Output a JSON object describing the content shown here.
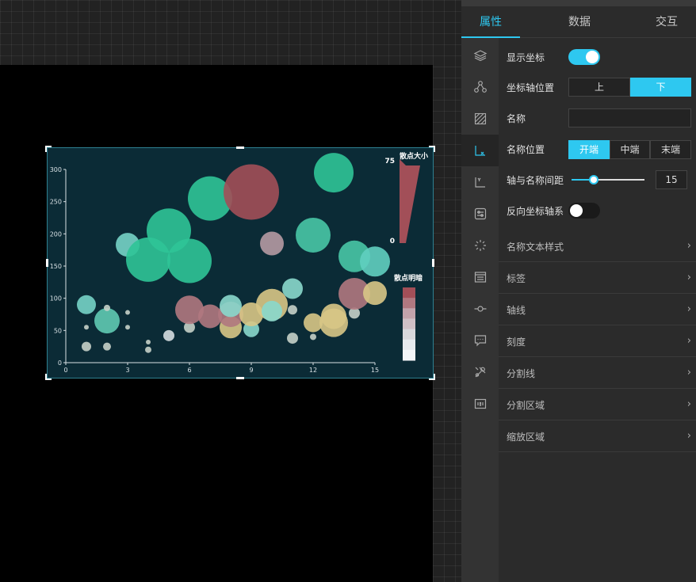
{
  "colors": {
    "accent": "#2ec8f0",
    "chart_bg": "#0b2b36",
    "bubble_green": "#2fc497",
    "bubble_red": "#a24f58",
    "bubble_yellow": "#d8c786"
  },
  "tabs": [
    {
      "label": "属性",
      "active": true
    },
    {
      "label": "数据",
      "active": false
    },
    {
      "label": "交互",
      "active": false
    }
  ],
  "side_icons": [
    {
      "name": "layers-icon"
    },
    {
      "name": "nodes-icon"
    },
    {
      "name": "grid-pattern-icon"
    },
    {
      "name": "x-axis-icon",
      "active": true
    },
    {
      "name": "y-axis-icon"
    },
    {
      "name": "settings-card-icon"
    },
    {
      "name": "sparkle-icon"
    },
    {
      "name": "legend-list-icon"
    },
    {
      "name": "line-node-icon"
    },
    {
      "name": "tooltip-icon"
    },
    {
      "name": "tools-icon"
    },
    {
      "name": "ratio-icon"
    }
  ],
  "props": {
    "show_axis": {
      "label": "显示坐标",
      "on": true
    },
    "axis_position": {
      "label": "坐标轴位置",
      "options": [
        "上",
        "下"
      ],
      "selected": 1
    },
    "name": {
      "label": "名称",
      "value": ""
    },
    "name_position": {
      "label": "名称位置",
      "options": [
        "开端",
        "中端",
        "末端"
      ],
      "selected": 0
    },
    "name_gap": {
      "label": "轴与名称间距",
      "value": "15",
      "slider_fraction": 0.3
    },
    "reverse_axis": {
      "label": "反向坐标轴系",
      "on": false
    }
  },
  "sections": [
    {
      "label": "名称文本样式"
    },
    {
      "label": "标签"
    },
    {
      "label": "轴线"
    },
    {
      "label": "刻度"
    },
    {
      "label": "分割线"
    },
    {
      "label": "分割区域"
    },
    {
      "label": "缩放区域"
    }
  ],
  "chart_data": {
    "type": "scatter",
    "x_ticks": [
      "0",
      "3",
      "6",
      "9",
      "12",
      "15"
    ],
    "y_ticks": [
      "0",
      "50",
      "100",
      "150",
      "200",
      "250",
      "300"
    ],
    "xlim": [
      0,
      15
    ],
    "ylim": [
      0,
      300
    ],
    "points": [
      {
        "x": 1,
        "y": 25,
        "size": 6,
        "color": "#c5d0c8"
      },
      {
        "x": 1,
        "y": 55,
        "size": 3,
        "color": "#c5d0c8"
      },
      {
        "x": 1,
        "y": 90,
        "size": 12,
        "color": "#76d3c6"
      },
      {
        "x": 2,
        "y": 25,
        "size": 5,
        "color": "#c5d0c8"
      },
      {
        "x": 2,
        "y": 65,
        "size": 16,
        "color": "#5fcab2"
      },
      {
        "x": 2,
        "y": 85,
        "size": 4,
        "color": "#c5d0c8"
      },
      {
        "x": 3,
        "y": 55,
        "size": 3,
        "color": "#c5d0c8"
      },
      {
        "x": 3,
        "y": 78,
        "size": 3,
        "color": "#c5d0c8"
      },
      {
        "x": 3,
        "y": 183,
        "size": 15,
        "color": "#76d3c6"
      },
      {
        "x": 4,
        "y": 20,
        "size": 4,
        "color": "#c5d0c8"
      },
      {
        "x": 4,
        "y": 32,
        "size": 3,
        "color": "#c5d0c8"
      },
      {
        "x": 4,
        "y": 160,
        "size": 28,
        "color": "#2fc497"
      },
      {
        "x": 5,
        "y": 42,
        "size": 7,
        "color": "#d5dde0"
      },
      {
        "x": 5,
        "y": 205,
        "size": 28,
        "color": "#2fc497"
      },
      {
        "x": 6,
        "y": 55,
        "size": 7,
        "color": "#c5d0c8"
      },
      {
        "x": 6,
        "y": 82,
        "size": 18,
        "color": "#b07880"
      },
      {
        "x": 6,
        "y": 158,
        "size": 28,
        "color": "#2fc497"
      },
      {
        "x": 7,
        "y": 72,
        "size": 15,
        "color": "#b07880"
      },
      {
        "x": 7,
        "y": 255,
        "size": 28,
        "color": "#2fc497"
      },
      {
        "x": 8,
        "y": 55,
        "size": 14,
        "color": "#d8c786"
      },
      {
        "x": 8,
        "y": 75,
        "size": 16,
        "color": "#b07880"
      },
      {
        "x": 8,
        "y": 88,
        "size": 14,
        "color": "#8ad8cc"
      },
      {
        "x": 9,
        "y": 52,
        "size": 10,
        "color": "#8ad8cc"
      },
      {
        "x": 9,
        "y": 75,
        "size": 15,
        "color": "#d8c786"
      },
      {
        "x": 9,
        "y": 265,
        "size": 35,
        "color": "#a24f58"
      },
      {
        "x": 10,
        "y": 90,
        "size": 20,
        "color": "#d8c786"
      },
      {
        "x": 10,
        "y": 80,
        "size": 13,
        "color": "#8ad8cc"
      },
      {
        "x": 10,
        "y": 185,
        "size": 15,
        "color": "#b59aa3"
      },
      {
        "x": 11,
        "y": 38,
        "size": 7,
        "color": "#c5d0c8"
      },
      {
        "x": 11,
        "y": 82,
        "size": 6,
        "color": "#c5d0c8"
      },
      {
        "x": 11,
        "y": 115,
        "size": 13,
        "color": "#8ad8cc"
      },
      {
        "x": 12,
        "y": 40,
        "size": 4,
        "color": "#c5d0c8"
      },
      {
        "x": 12,
        "y": 62,
        "size": 12,
        "color": "#d8c786"
      },
      {
        "x": 12,
        "y": 198,
        "size": 22,
        "color": "#48c7a6"
      },
      {
        "x": 13,
        "y": 62,
        "size": 18,
        "color": "#d8c786"
      },
      {
        "x": 13,
        "y": 72,
        "size": 16,
        "color": "#d8c786"
      },
      {
        "x": 13,
        "y": 295,
        "size": 25,
        "color": "#2fc497"
      },
      {
        "x": 14,
        "y": 77,
        "size": 7,
        "color": "#c5d0c8"
      },
      {
        "x": 14,
        "y": 107,
        "size": 20,
        "color": "#b07880"
      },
      {
        "x": 14,
        "y": 165,
        "size": 20,
        "color": "#48c7a6"
      },
      {
        "x": 15,
        "y": 108,
        "size": 15,
        "color": "#d8c786"
      },
      {
        "x": 15,
        "y": 157,
        "size": 19,
        "color": "#60cfc0"
      }
    ],
    "visual_maps": [
      {
        "title": "散点大小",
        "max_label": "75",
        "min_label": "0",
        "color": "#a24f58"
      },
      {
        "title": "散点明暗",
        "colors": [
          "#a24f58",
          "#b07880",
          "#c2a3ab",
          "#cfc0c6",
          "#d8d8dc",
          "#e6eaee",
          "#f4f6f8"
        ]
      }
    ]
  }
}
